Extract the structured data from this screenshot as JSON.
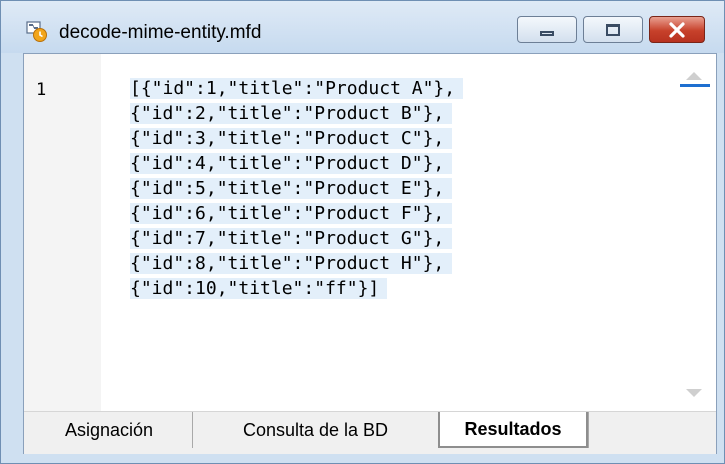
{
  "window": {
    "title": "decode-mime-entity.mfd",
    "app_icon": "mapforce-file-icon",
    "controls": [
      "minimize",
      "maximize",
      "close"
    ]
  },
  "editor": {
    "line_number": "1",
    "lines": [
      "[{\"id\":1,\"title\":\"Product A\"},",
      "{\"id\":2,\"title\":\"Product B\"},",
      "{\"id\":3,\"title\":\"Product C\"},",
      "{\"id\":4,\"title\":\"Product D\"},",
      "{\"id\":5,\"title\":\"Product E\"},",
      "{\"id\":6,\"title\":\"Product F\"},",
      "{\"id\":7,\"title\":\"Product G\"},",
      "{\"id\":8,\"title\":\"Product H\"},",
      "{\"id\":10,\"title\":\"ff\"}]"
    ]
  },
  "tabs": [
    {
      "label": "Asignación",
      "active": false
    },
    {
      "label": "Consulta de la BD",
      "active": false
    },
    {
      "label": "Resultados",
      "active": true
    }
  ],
  "colors": {
    "selection": "#e3effa",
    "close_button": "#c7412b",
    "scroll_thumb": "#1e6fd0"
  }
}
